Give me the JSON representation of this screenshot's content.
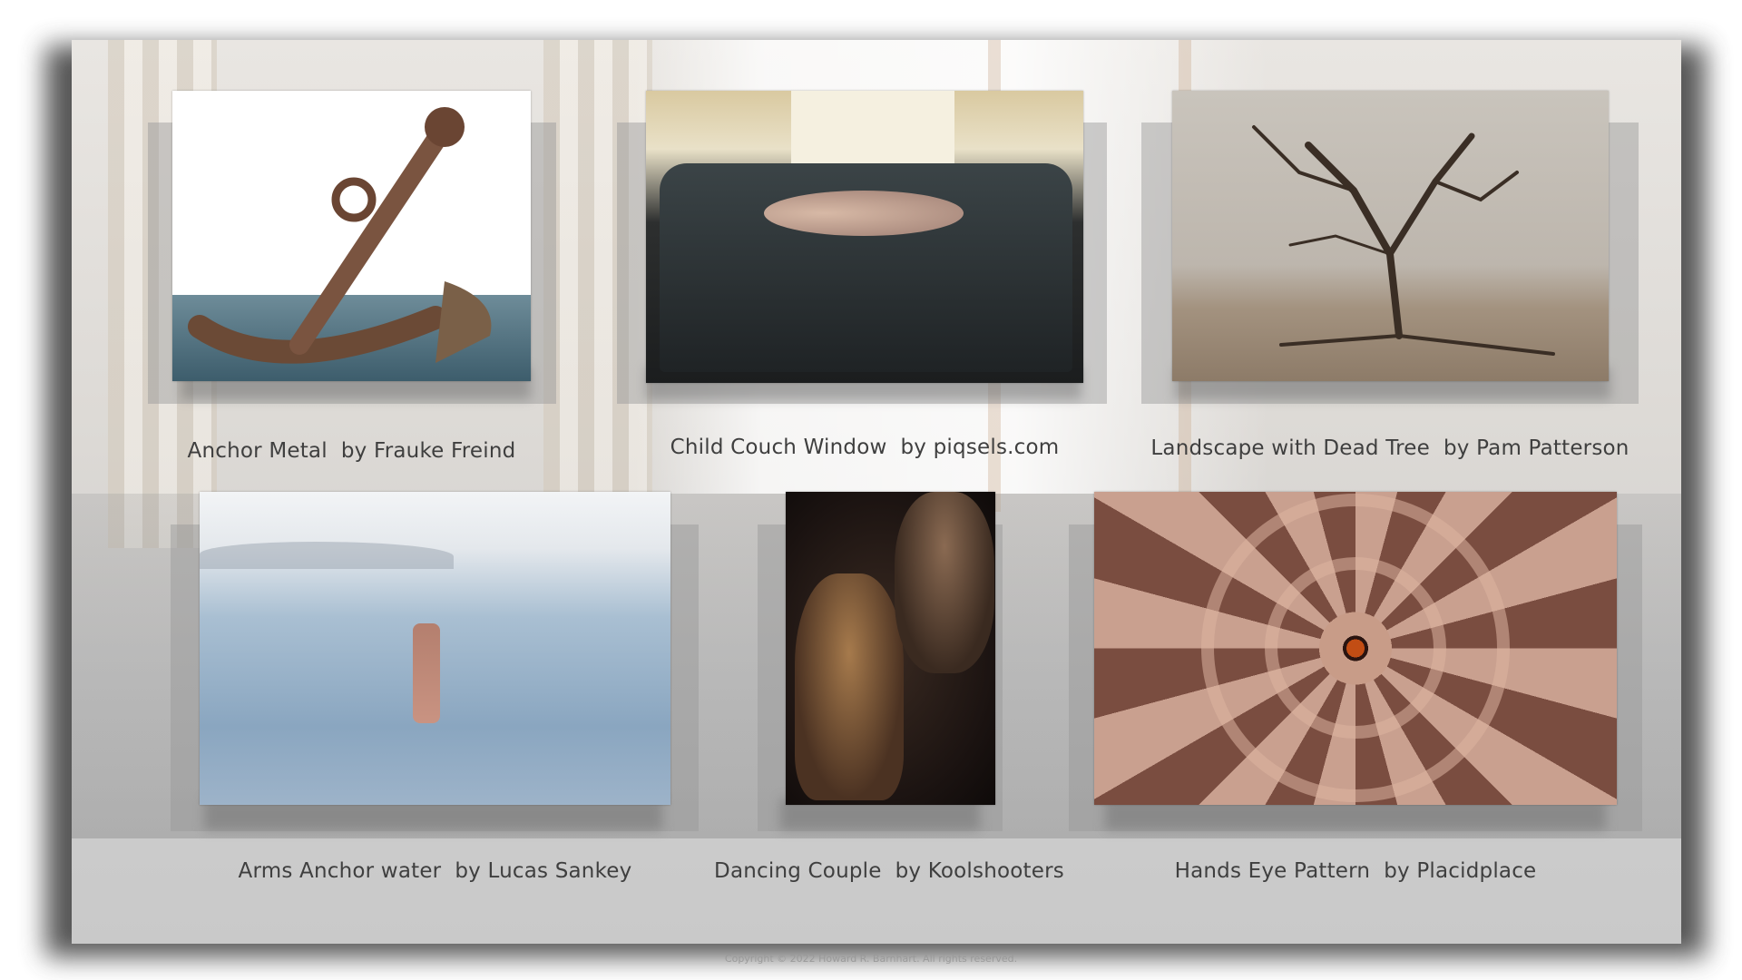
{
  "gallery": {
    "items": [
      {
        "title": "Anchor Metal",
        "credit": "by Frauke Freind",
        "caption": "Anchor Metal  by Frauke Freind",
        "image_icon": "anchor-photo"
      },
      {
        "title": "Child Couch Window",
        "credit": "by piqsels.com",
        "caption": "Child Couch Window  by piqsels.com",
        "image_icon": "child-couch-photo"
      },
      {
        "title": "Landscape with Dead Tree",
        "credit": "by Pam Patterson",
        "caption": "Landscape with Dead Tree  by Pam Patterson",
        "image_icon": "dead-tree-photo"
      },
      {
        "title": "Arms Anchor water",
        "credit": "by Lucas Sankey",
        "caption": "Arms Anchor water  by Lucas Sankey",
        "image_icon": "arms-water-photo"
      },
      {
        "title": "Dancing Couple",
        "credit": "by Koolshooters",
        "caption": "Dancing Couple  by Koolshooters",
        "image_icon": "dancing-couple-photo"
      },
      {
        "title": "Hands Eye Pattern",
        "credit": "by Placidplace",
        "caption": "Hands Eye Pattern  by Placidplace",
        "image_icon": "hands-eye-photo"
      }
    ]
  },
  "footer": {
    "copyright": "Copyright © 2022 Howard R. Barnhart.  All rights reserved."
  },
  "colors": {
    "caption_text": "#3f3f3f",
    "frame_shadow": "#3a3a3a",
    "copyright_text": "#9a9a9a"
  }
}
